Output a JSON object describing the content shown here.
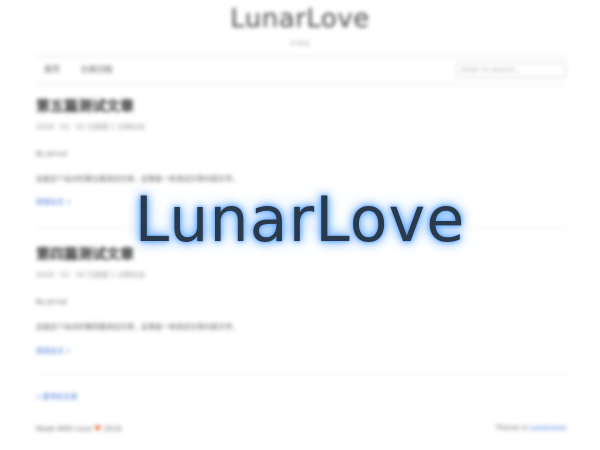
{
  "site": {
    "title": "LunarLove",
    "subtitle": "A blog"
  },
  "nav": {
    "items": [
      "首页",
      "分类归档"
    ],
    "search_placeholder": "Enter to search..."
  },
  "posts": [
    {
      "title": "第五篇测试文章",
      "meta": "2018 · 01 · 02 已阅读 1 分钟左右",
      "author": "By Jerval",
      "excerpt": "这是这个站点的第五篇测试文章，这里是一些测试文章内容文字。",
      "more": "阅读全文 »"
    },
    {
      "title": "第四篇测试文章",
      "meta": "2018 · 01 · 02 已阅读 1 分钟左右",
      "author": "By Jerval",
      "excerpt": "这是这个站点的第四篇测试文章，这里是一些测试文章内容文字。",
      "more": "阅读全文 »"
    }
  ],
  "pagination": {
    "older": "« 更早的文章"
  },
  "footer": {
    "left_prefix": "Made With Love",
    "heart": "♥",
    "left_suffix": "2018",
    "right_prefix": "Theme is ",
    "right_link": "LunarLove"
  },
  "overlay": {
    "watermark": "LunarLove",
    "glow_color": "#5aa2ff",
    "text_color": "#2b3a4a"
  }
}
